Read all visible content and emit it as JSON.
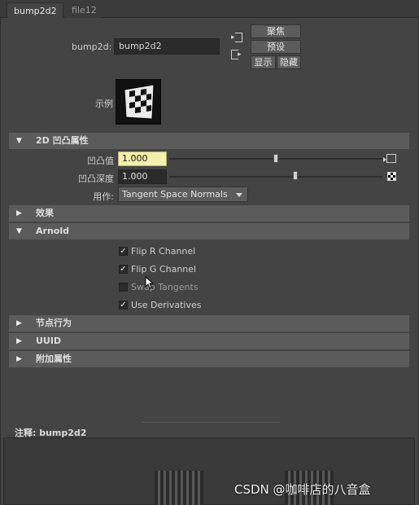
{
  "tabs": [
    {
      "label": "bump2d2",
      "active": true
    },
    {
      "label": "file12",
      "active": false
    }
  ],
  "node": {
    "type_label": "bump2d:",
    "name_value": "bump2d2"
  },
  "buttons": {
    "focus": "聚焦",
    "preset": "预设",
    "show": "显示",
    "hide": "隐藏"
  },
  "sample_label": "示例",
  "sections": {
    "bump_attrs": "2D 凹凸属性",
    "effects": "效果",
    "arnold": "Arnold",
    "node_behavior": "节点行为",
    "uuid": "UUID",
    "extra_attrs": "附加属性"
  },
  "bump": {
    "value_label": "凹凸值",
    "value": "1.000",
    "value_slider_fraction": 0.5,
    "depth_label": "凹凸深度",
    "depth": "1.000",
    "depth_slider_fraction": 0.59,
    "use_as_label": "用作:",
    "use_as_value": "Tangent Space Normals"
  },
  "arnold": {
    "checks": [
      {
        "label": "Flip R Channel",
        "checked": true
      },
      {
        "label": "Flip G Channel",
        "checked": true
      },
      {
        "label": "Swap Tangents",
        "checked": false
      },
      {
        "label": "Use Derivatives",
        "checked": true
      }
    ]
  },
  "notes_label": "注释:  bump2d2",
  "watermark": "CSDN @咖啡店的八音盒",
  "colors": {
    "panel_bg": "#444444",
    "section_bg": "#5b5b5b",
    "field_bg": "#2b2b2b",
    "highlight_field": "#f3f0a9"
  }
}
